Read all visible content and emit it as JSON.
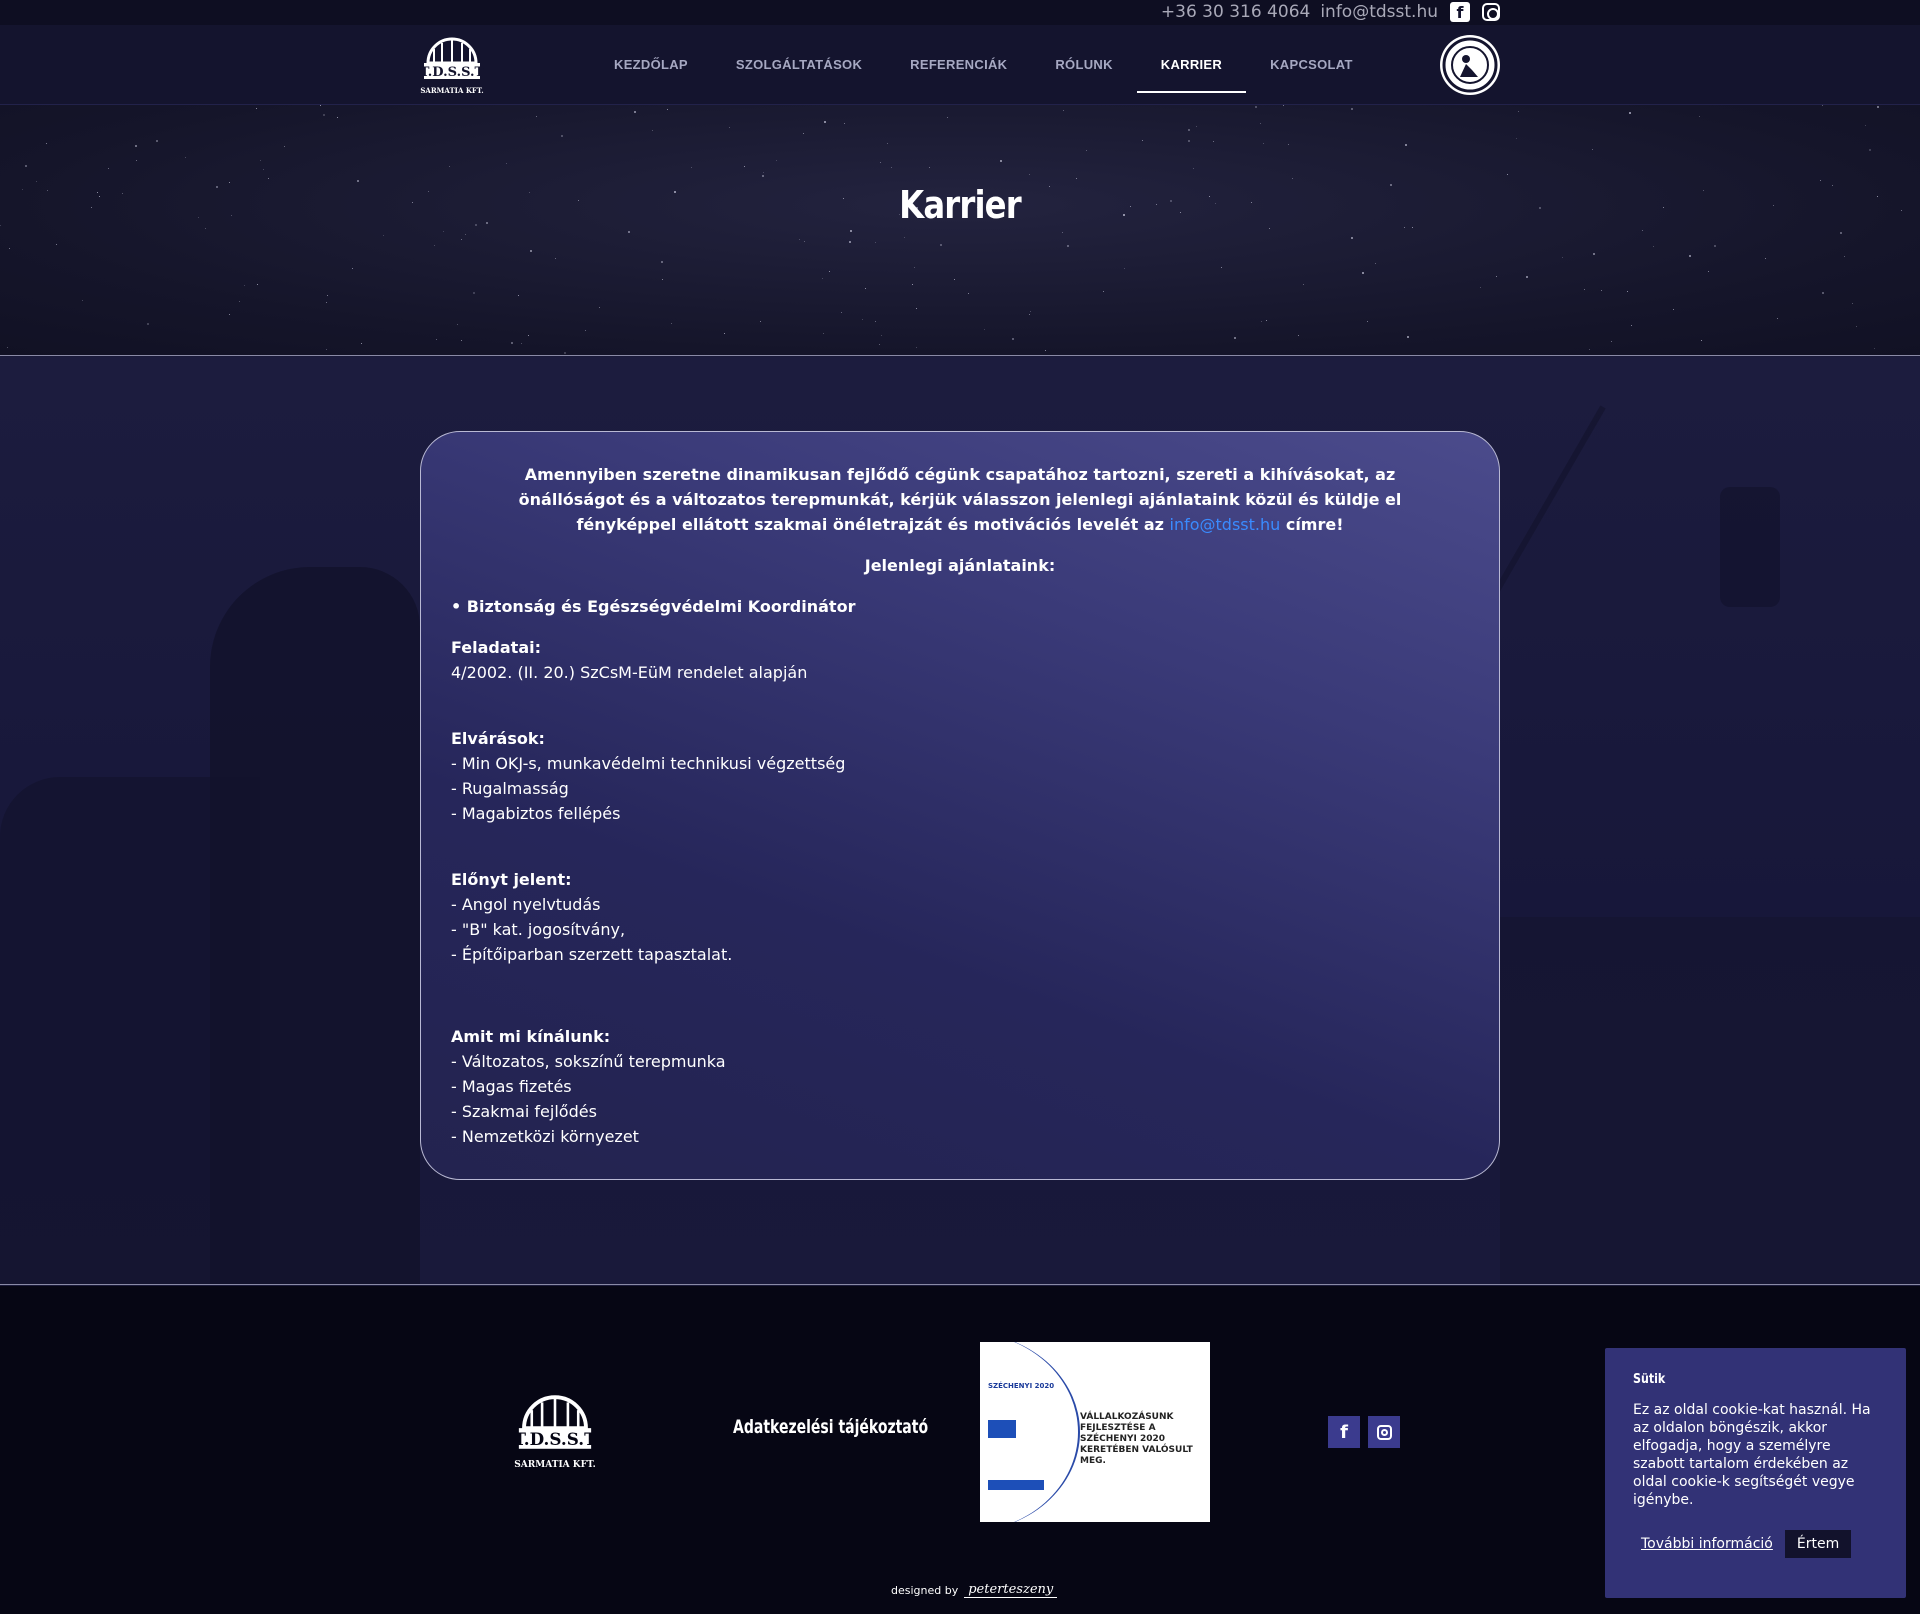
{
  "topbar": {
    "phone": "+36 30 316 4064",
    "email": "info@tdsst.hu",
    "facebook_icon": "facebook-icon",
    "instagram_icon": "instagram-icon"
  },
  "nav": {
    "logo_text": "T.D.S.S.T",
    "logo_sub": "SARMATIA KFT.",
    "items": [
      {
        "label": "KEZDŐLAP"
      },
      {
        "label": "SZOLGÁLTATÁSOK"
      },
      {
        "label": "REFERENCIÁK"
      },
      {
        "label": "RÓLUNK"
      },
      {
        "label": "KARRIER",
        "active": true
      },
      {
        "label": "KAPCSOLAT"
      }
    ]
  },
  "hero": {
    "title": "Karrier"
  },
  "card": {
    "intro": "Amennyiben szeretne dinamikusan fejlődő cégünk csapatához tartozni, szereti a kihívásokat, az önállóságot és a változatos terepmunkát, kérjük válasszon jelenlegi ajánlataink közül és küldje el fényképpel ellátott szakmai önéletrajzát és motivációs levelét az",
    "intro_email": "info@tdsst.hu",
    "intro_end": "címre!",
    "offers_title": "Jelenlegi ajánlataink:",
    "position": "• Biztonság és Egészségvédelmi Koordinátor",
    "tasks_title": "Feladatai:",
    "tasks": [
      "4/2002. (II. 20.) SzCsM-EüM rendelet alapján"
    ],
    "requirements_title": "Elvárások:",
    "requirements": [
      "- Min OKJ-s, munkavédelmi technikusi végzettség",
      "- Rugalmasság",
      "- Magabiztos fellépés"
    ],
    "advantages_title": "Előnyt jelent:",
    "advantages": [
      "- Angol nyelvtudás",
      "- \"B\" kat. jogosítvány,",
      "- Építőiparban szerzett tapasztalat."
    ],
    "offer_title": "Amit mi kínálunk:",
    "offer": [
      "- Változatos, sokszínű terepmunka",
      "- Magas fizetés",
      "- Szakmai fejlődés",
      "- Nemzetközi környezet"
    ]
  },
  "footer": {
    "logo_text": "T.D.S.S.T",
    "logo_sub": "SARMATIA KFT.",
    "privacy_link": "Adatkezelési tájékoztató",
    "szechenyi_logo": "SZÉCHENYI 2020",
    "szechenyi_text": "VÁLLALKOZÁSUNK FEJLESZTÉSE A SZÉCHENYI 2020 KERETÉBEN VALÓSULT MEG.",
    "designed_by": "designed by",
    "designer": "peterteszeny"
  },
  "cookie": {
    "title": "Sütik",
    "text": "Ez az oldal cookie-kat használ. Ha az oldalon böngészik, akkor elfogadja, hogy a személyre szabott tartalom érdekében az oldal cookie-k segítségét vegye igénybe.",
    "more": "További információ",
    "ok": "Értem"
  },
  "colors": {
    "nav_bg": "#14142e",
    "card_top": "#4b4b8c",
    "link": "#3a8bff",
    "cookie_bg": "#323276",
    "footer_bg": "#060614"
  }
}
